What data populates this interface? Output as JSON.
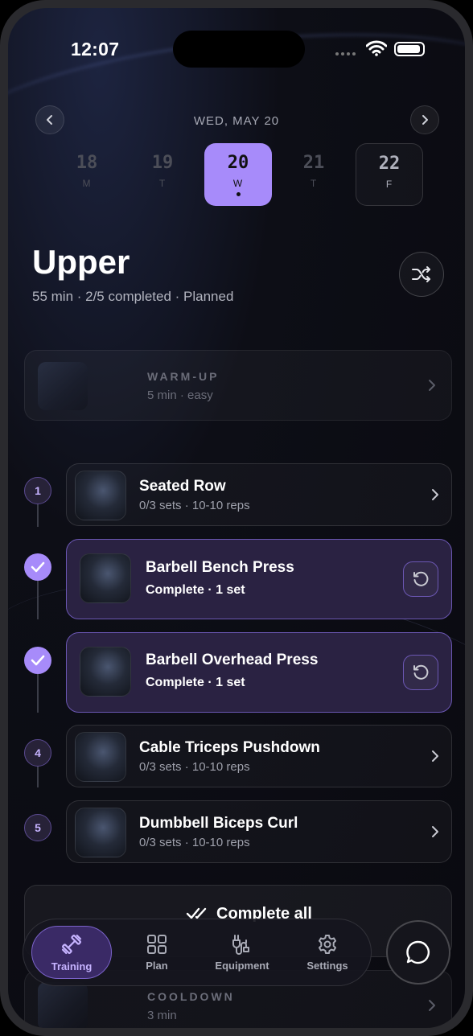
{
  "status_bar": {
    "time": "12:07"
  },
  "date_nav": {
    "date_label": "WED, MAY 20",
    "days": [
      {
        "num": "18",
        "weekday": "M"
      },
      {
        "num": "19",
        "weekday": "T"
      },
      {
        "num": "20",
        "weekday": "W"
      },
      {
        "num": "21",
        "weekday": "T"
      },
      {
        "num": "22",
        "weekday": "F"
      }
    ]
  },
  "workout": {
    "title": "Upper",
    "subtitle": "55 min · 2/5 completed · Planned"
  },
  "warmup": {
    "title": "WARM-UP",
    "sub": "5 min · easy"
  },
  "exercises": [
    {
      "marker": "1",
      "name": "Seated Row",
      "meta": "0/3 sets · 10-10 reps"
    },
    {
      "marker": "",
      "name": "Barbell Bench Press",
      "meta": "Complete · 1 set"
    },
    {
      "marker": "",
      "name": "Barbell Overhead Press",
      "meta": "Complete · 1 set"
    },
    {
      "marker": "4",
      "name": "Cable Triceps Pushdown",
      "meta": "0/3 sets · 10-10 reps"
    },
    {
      "marker": "5",
      "name": "Dumbbell Biceps Curl",
      "meta": "0/3 sets · 10-10 reps"
    }
  ],
  "complete_all": {
    "label": "Complete all"
  },
  "cooldown": {
    "title": "COOLDOWN",
    "sub": "3 min"
  },
  "tabs": [
    {
      "label": "Training",
      "icon": "dumbbell-icon"
    },
    {
      "label": "Plan",
      "icon": "grid-icon"
    },
    {
      "label": "Equipment",
      "icon": "equipment-icon"
    },
    {
      "label": "Settings",
      "icon": "gear-icon"
    }
  ],
  "colors": {
    "accent": "#a78bfa",
    "background": "#0a0a10"
  }
}
